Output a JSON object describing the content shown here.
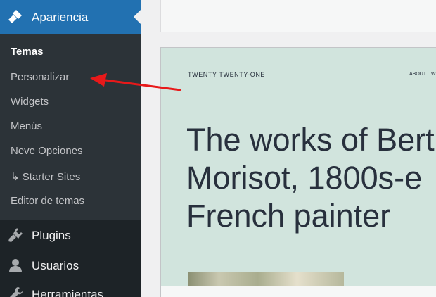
{
  "sidebar": {
    "header": {
      "label": "Apariencia",
      "icon": "paintbrush-icon"
    },
    "submenu": [
      {
        "label": "Temas",
        "current": true
      },
      {
        "label": "Personalizar"
      },
      {
        "label": "Widgets"
      },
      {
        "label": "Menús"
      },
      {
        "label": "Neve Opciones"
      },
      {
        "label": "↳ Starter Sites"
      },
      {
        "label": "Editor de temas"
      }
    ],
    "items": [
      {
        "label": "Plugins",
        "icon": "plugin-icon"
      },
      {
        "label": "Usuarios",
        "icon": "user-icon"
      },
      {
        "label": "Herramientas",
        "icon": "wrench-icon"
      }
    ]
  },
  "preview": {
    "site_title": "TWENTY TWENTY-ONE",
    "nav": [
      "ABOUT",
      "WO"
    ],
    "headline_lines": [
      "The works of Bert",
      "Morisot, 1800s-e",
      "French painter"
    ]
  },
  "colors": {
    "sidebar_bg": "#1d2327",
    "submenu_bg": "#2c3338",
    "accent": "#2271b1",
    "preview_bg": "#d1e4dd",
    "annotation_arrow": "#e8191a"
  }
}
